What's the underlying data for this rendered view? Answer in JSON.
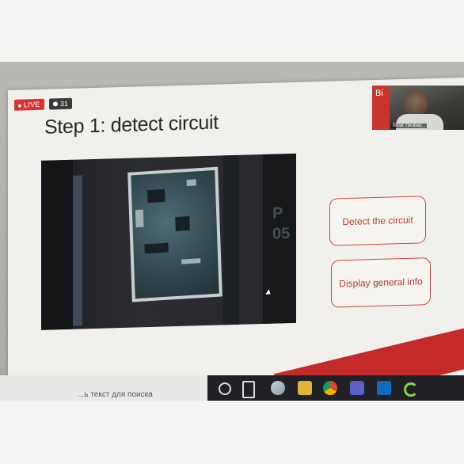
{
  "stream": {
    "live_label": "LIVE",
    "viewer_count": "31"
  },
  "slide": {
    "title": "Step 1: detect circuit",
    "buttons": {
      "detect": "Detect the circuit",
      "display_info": "Display general info"
    },
    "photo_overlay_text": [
      "P",
      "05"
    ]
  },
  "presenter": {
    "brand_text": "Bi",
    "name": "Bolat Tleubay..."
  },
  "taskbar": {
    "search_text": "...ь текст для поиска",
    "icons": [
      "task-view-icon",
      "store-icon",
      "file-explorer-icon",
      "chrome-icon",
      "teams-icon",
      "outlook-icon",
      "spinner-icon"
    ]
  },
  "colors": {
    "accent_red": "#c42a2a",
    "button_text": "#b23a30",
    "slide_bg": "#f1f0ec"
  }
}
